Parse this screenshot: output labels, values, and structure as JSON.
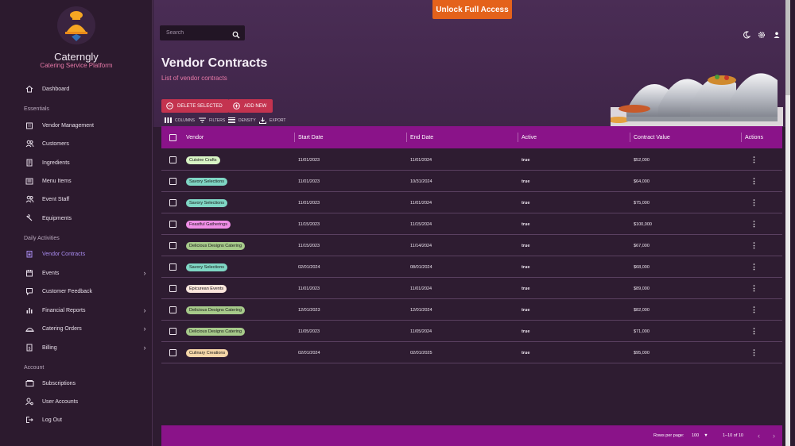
{
  "brand": {
    "name": "Caterngly",
    "subtitle": "Catering Service Platform"
  },
  "sidebar": {
    "dashboard": "Dashboard",
    "sections": {
      "essentials": "Essentials",
      "daily": "Daily Activities",
      "account": "Account"
    },
    "essentials": [
      "Vendor Management",
      "Customers",
      "Ingredients",
      "Menu Items",
      "Event Staff",
      "Equipments"
    ],
    "daily": [
      "Vendor Contracts",
      "Events",
      "Customer Feedback",
      "Financial Reports",
      "Catering Orders",
      "Billing"
    ],
    "account": [
      "Subscriptions",
      "User Accounts",
      "Log Out"
    ]
  },
  "header": {
    "unlock": "Unlock Full Access",
    "search_placeholder": "Search"
  },
  "page": {
    "title": "Vendor Contracts",
    "subtitle": "List of vendor contracts"
  },
  "actions": {
    "delete": "DELETE SELECTED",
    "add": "ADD NEW"
  },
  "toolbar": {
    "columns": "COLUMNS",
    "filters": "FILTERS",
    "density": "DENSITY",
    "export": "EXPORT"
  },
  "table": {
    "headers": [
      "Vendor",
      "Start Date",
      "End Date",
      "Active",
      "Contract Value",
      "Actions"
    ],
    "rows": [
      {
        "vendor": "Cuisine Crafts",
        "start": "11/01/2023",
        "end": "11/01/2024",
        "active": "true",
        "value": "$52,000",
        "chip": "#d8f3c4"
      },
      {
        "vendor": "Savory Selections",
        "start": "11/01/2023",
        "end": "10/31/2024",
        "active": "true",
        "value": "$64,000",
        "chip": "#7fd6c4"
      },
      {
        "vendor": "Savory Selections",
        "start": "11/01/2023",
        "end": "11/01/2024",
        "active": "true",
        "value": "$75,000",
        "chip": "#7fd6c4"
      },
      {
        "vendor": "Feastful Gatherings",
        "start": "11/15/2023",
        "end": "11/15/2024",
        "active": "true",
        "value": "$100,000",
        "chip": "#ef8ee6"
      },
      {
        "vendor": "Delicious Designs Catering",
        "start": "11/15/2023",
        "end": "11/14/2024",
        "active": "true",
        "value": "$67,000",
        "chip": "#a6c98a"
      },
      {
        "vendor": "Savory Selections",
        "start": "02/01/2024",
        "end": "08/01/2024",
        "active": "true",
        "value": "$68,000",
        "chip": "#7fd6c4"
      },
      {
        "vendor": "Epicurean Events",
        "start": "11/01/2023",
        "end": "11/01/2024",
        "active": "true",
        "value": "$89,000",
        "chip": "#fbe6dc"
      },
      {
        "vendor": "Delicious Designs Catering",
        "start": "12/01/2023",
        "end": "12/01/2024",
        "active": "true",
        "value": "$82,000",
        "chip": "#a6c98a"
      },
      {
        "vendor": "Delicious Designs Catering",
        "start": "11/05/2023",
        "end": "11/05/2024",
        "active": "true",
        "value": "$71,000",
        "chip": "#a6c98a"
      },
      {
        "vendor": "Culinary Creations",
        "start": "02/01/2024",
        "end": "02/01/2025",
        "active": "true",
        "value": "$95,000",
        "chip": "#f5d6a8"
      }
    ]
  },
  "footer": {
    "rows_label": "Rows per page:",
    "rows_value": "100",
    "range": "1–10 of 10"
  },
  "colors": {
    "accent": "#8a1389",
    "button": "#c4334f",
    "unlock": "#e4621b",
    "active_nav": "#a98cf0"
  }
}
